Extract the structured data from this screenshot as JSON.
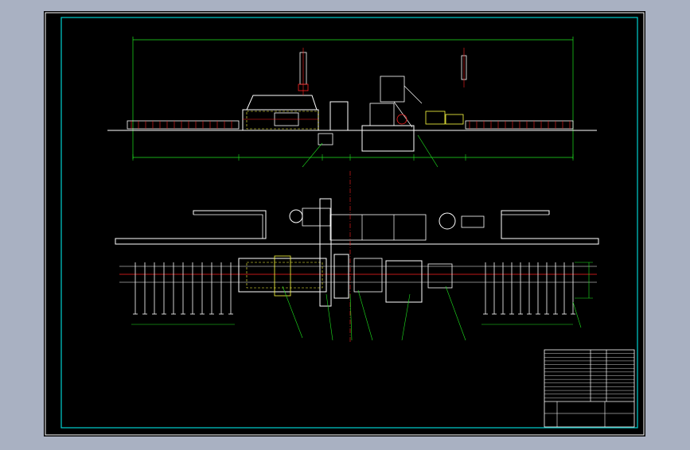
{
  "drawing": {
    "background_color": "#000000",
    "frame_color": "#00d0d0",
    "outline_color": "#ffffff",
    "dimension_color": "#1fe51f",
    "center_line_color": "#ff2020",
    "part_color": "#ffff40"
  },
  "title_block": {
    "rows": 14
  }
}
